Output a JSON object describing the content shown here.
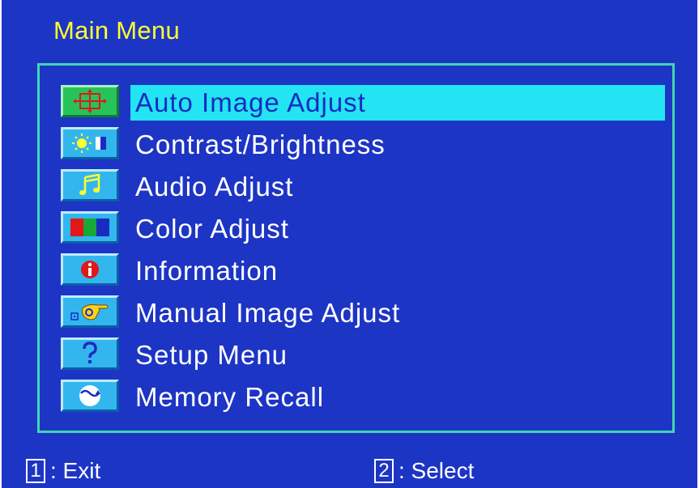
{
  "osd": {
    "title": "Main Menu",
    "items": [
      {
        "label": "Auto Image Adjust",
        "icon": "auto-adjust-icon",
        "selected": true
      },
      {
        "label": "Contrast/Brightness",
        "icon": "contrast-brightness-icon",
        "selected": false
      },
      {
        "label": "Audio Adjust",
        "icon": "music-notes-icon",
        "selected": false
      },
      {
        "label": "Color Adjust",
        "icon": "color-bars-icon",
        "selected": false
      },
      {
        "label": "Information",
        "icon": "info-icon",
        "selected": false
      },
      {
        "label": "Manual Image Adjust",
        "icon": "hand-adjust-icon",
        "selected": false
      },
      {
        "label": "Setup Menu",
        "icon": "question-mark-icon",
        "selected": false
      },
      {
        "label": "Memory Recall",
        "icon": "memory-recall-icon",
        "selected": false
      }
    ],
    "footer": {
      "exit_key": "1",
      "exit_label": ": Exit",
      "select_key": "2",
      "select_label": ": Select"
    }
  },
  "colors": {
    "background": "#1d35c4",
    "title": "#ffff33",
    "frame_border": "#40d6b2",
    "highlight": "#22e4f2",
    "text": "#ffffff"
  }
}
